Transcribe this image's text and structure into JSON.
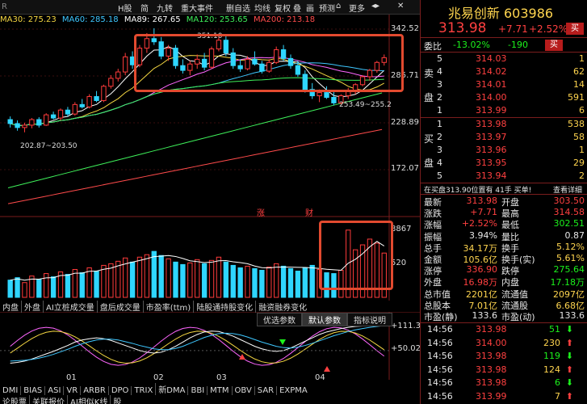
{
  "toolbar": {
    "r_label": "R",
    "items": [
      "H股",
      "简",
      "九转",
      "重大事件",
      "删自选",
      "均线",
      "复权",
      "叠",
      "画",
      "预测",
      "更多"
    ],
    "icons": [
      "home-icon",
      "expand-icon",
      "close-icon"
    ]
  },
  "ma": {
    "items": [
      {
        "label": "MA30: 275.23",
        "color": "#f5d742"
      },
      {
        "label": "MA60: 285.18",
        "color": "#3ec7ff"
      },
      {
        "label": "MA89: 267.65",
        "color": "#ffffff"
      },
      {
        "label": "MA120: 253.65",
        "color": "#3ef05a"
      },
      {
        "label": "MA200: 213.18",
        "color": "#ff4b4b"
      }
    ]
  },
  "yaxis": {
    "main": [
      "342.52",
      "285.71",
      "228.89",
      "172.07"
    ],
    "vol": [
      "8867",
      "520"
    ],
    "ind": [
      "+111.3",
      "+50.02"
    ]
  },
  "annot": {
    "high": "351.10",
    "mid": "253.49~255.2",
    "low": "202.87~203.50",
    "e1": "涨",
    "e2": "财"
  },
  "xticks": [
    "01",
    "02",
    "03",
    "04"
  ],
  "tabs1": [
    "内盘",
    "外盘",
    "AI立桩成交量",
    "盘后成交量",
    "市盈率(ttm)",
    "陆股通持股变化",
    "融资融券变化"
  ],
  "buttons": [
    "优选参数",
    "默认参数",
    "指标说明"
  ],
  "tabs2": [
    "DMI",
    "BIAS",
    "ASI",
    "VR",
    "ARBR",
    "DPO",
    "TRIX",
    "新DMA",
    "BBI",
    "MTM",
    "OBV",
    "SAR",
    "EXPMA"
  ],
  "tabs3": [
    "论股票",
    "关联报价",
    "AI相似K线",
    "股"
  ],
  "chart_data": {
    "type": "candlestick",
    "main_ylim": [
      120,
      350
    ],
    "vol_ylim": [
      0,
      8867
    ],
    "candles": [
      [
        236,
        240,
        226,
        231
      ],
      [
        231,
        235,
        222,
        226
      ],
      [
        226,
        232,
        220,
        229
      ],
      [
        229,
        238,
        225,
        236
      ],
      [
        236,
        239,
        226,
        229
      ],
      [
        229,
        244,
        228,
        242
      ],
      [
        242,
        246,
        236,
        238
      ],
      [
        238,
        250,
        235,
        248
      ],
      [
        248,
        252,
        240,
        243
      ],
      [
        243,
        258,
        241,
        255
      ],
      [
        255,
        262,
        250,
        252
      ],
      [
        252,
        268,
        250,
        265
      ],
      [
        265,
        272,
        258,
        260
      ],
      [
        260,
        280,
        258,
        278
      ],
      [
        278,
        292,
        275,
        288
      ],
      [
        288,
        300,
        284,
        296
      ],
      [
        296,
        320,
        292,
        315
      ],
      [
        315,
        322,
        300,
        305
      ],
      [
        305,
        330,
        302,
        326
      ],
      [
        326,
        345,
        320,
        338
      ],
      [
        338,
        351,
        330,
        334
      ],
      [
        334,
        340,
        312,
        316
      ],
      [
        316,
        330,
        310,
        326
      ],
      [
        326,
        330,
        300,
        304
      ],
      [
        304,
        312,
        294,
        298
      ],
      [
        298,
        310,
        292,
        306
      ],
      [
        306,
        318,
        300,
        312
      ],
      [
        312,
        320,
        298,
        302
      ],
      [
        302,
        328,
        300,
        325
      ],
      [
        325,
        340,
        322,
        336
      ],
      [
        336,
        342,
        316,
        320
      ],
      [
        320,
        326,
        300,
        304
      ],
      [
        304,
        312,
        296,
        300
      ],
      [
        300,
        316,
        298,
        312
      ],
      [
        312,
        322,
        304,
        306
      ],
      [
        306,
        310,
        294,
        297
      ],
      [
        297,
        312,
        295,
        308
      ],
      [
        308,
        328,
        306,
        324
      ],
      [
        324,
        330,
        310,
        313
      ],
      [
        313,
        318,
        300,
        304
      ],
      [
        304,
        310,
        290,
        293
      ],
      [
        293,
        298,
        270,
        274
      ],
      [
        274,
        282,
        262,
        266
      ],
      [
        266,
        274,
        258,
        270
      ],
      [
        270,
        278,
        262,
        264
      ],
      [
        264,
        272,
        254,
        257
      ],
      [
        257,
        268,
        255,
        266
      ],
      [
        266,
        276,
        262,
        272
      ],
      [
        272,
        282,
        268,
        280
      ],
      [
        280,
        292,
        278,
        290
      ],
      [
        290,
        300,
        285,
        298
      ],
      [
        298,
        310,
        295,
        308
      ],
      [
        308,
        318,
        304,
        314
      ]
    ],
    "volumes": [
      2100,
      2400,
      1800,
      2600,
      2200,
      2900,
      2500,
      3100,
      2800,
      3400,
      3000,
      3600,
      3200,
      3900,
      4100,
      4400,
      4800,
      4300,
      4900,
      5200,
      5600,
      5100,
      4700,
      4300,
      4000,
      4200,
      4600,
      4100,
      4500,
      4900,
      4300,
      3900,
      3600,
      3800,
      3500,
      3300,
      3700,
      4100,
      3800,
      3500,
      3200,
      3600,
      3900,
      3400,
      3000,
      2900,
      3300,
      8200,
      5800,
      6400,
      7100,
      6600,
      5400
    ],
    "macd_dif": [
      20,
      22,
      25,
      30,
      36,
      42,
      48,
      55,
      62,
      70,
      75,
      78,
      80,
      78,
      74,
      68,
      62,
      56,
      50,
      46,
      44,
      46,
      52,
      60,
      70,
      80,
      88,
      94,
      96,
      95,
      90,
      84,
      76,
      68,
      60,
      54,
      50,
      48,
      50,
      56,
      64,
      72,
      80,
      88,
      94,
      98,
      102,
      105,
      107,
      108,
      110,
      111,
      111
    ],
    "macd_dea": [
      25,
      26,
      27,
      29,
      32,
      36,
      41,
      47,
      53,
      60,
      66,
      71,
      75,
      77,
      77,
      75,
      71,
      67,
      62,
      58,
      54,
      52,
      52,
      55,
      60,
      67,
      74,
      81,
      86,
      90,
      91,
      90,
      87,
      82,
      76,
      70,
      65,
      60,
      57,
      56,
      58,
      62,
      67,
      73,
      79,
      85,
      90,
      95,
      99,
      102,
      105,
      107,
      109
    ]
  },
  "panel": {
    "title": "兆易创新 603986",
    "price": "313.98",
    "change": "+7.71",
    "pct": "+2.52%",
    "add_btn": "买",
    "weibi_label": "委比",
    "weibi_value": "-13.02%",
    "weicha_value": "-190",
    "sell_btn": "买",
    "sell_side": "卖",
    "sell_side2": "盘",
    "buy_side": "买",
    "buy_side2": "盘",
    "sells": [
      {
        "n": "5",
        "p": "314.03",
        "v": "1"
      },
      {
        "n": "4",
        "p": "314.02",
        "v": "62"
      },
      {
        "n": "3",
        "p": "314.01",
        "v": "14"
      },
      {
        "n": "2",
        "p": "314.00",
        "v": "591"
      },
      {
        "n": "1",
        "p": "313.99",
        "v": "6"
      }
    ],
    "buys": [
      {
        "n": "1",
        "p": "313.98",
        "v": "538"
      },
      {
        "n": "2",
        "p": "313.97",
        "v": "58"
      },
      {
        "n": "3",
        "p": "313.96",
        "v": "1"
      },
      {
        "n": "4",
        "p": "313.95",
        "v": "29"
      },
      {
        "n": "5",
        "p": "313.94",
        "v": "2"
      }
    ],
    "notice": "在买盘313.90位置有 41手 买单!",
    "notice_link": "查看详细",
    "stats": [
      {
        "l1": "最新",
        "v1": "313.98",
        "c1": "red",
        "l2": "开盘",
        "v2": "303.50",
        "c2": "red"
      },
      {
        "l1": "涨跌",
        "v1": "+7.71",
        "c1": "red",
        "l2": "最高",
        "v2": "314.58",
        "c2": "red"
      },
      {
        "l1": "涨幅",
        "v1": "+2.52%",
        "c1": "red",
        "l2": "最低",
        "v2": "302.51",
        "c2": "green"
      },
      {
        "l1": "振幅",
        "v1": "3.94%",
        "c1": "white",
        "l2": "量比",
        "v2": "0.87",
        "c2": "white"
      },
      {
        "l1": "总手",
        "v1": "34.17万",
        "c1": "yel",
        "l2": "换手",
        "v2": "5.12%",
        "c2": "yel"
      },
      {
        "l1": "金额",
        "v1": "105.6亿",
        "c1": "yel",
        "l2": "换手(实)",
        "v2": "5.61%",
        "c2": "yel"
      },
      {
        "l1": "涨停",
        "v1": "336.90",
        "c1": "red",
        "l2": "跌停",
        "v2": "275.64",
        "c2": "green"
      },
      {
        "l1": "外盘",
        "v1": "16.98万",
        "c1": "red",
        "l2": "内盘",
        "v2": "17.18万",
        "c2": "green"
      },
      {
        "l1": "总市值",
        "v1": "2201亿",
        "c1": "yel",
        "l2": "流通值",
        "v2": "2097亿",
        "c2": "yel"
      },
      {
        "l1": "总股本",
        "v1": "7.01亿",
        "c1": "yel",
        "l2": "流通股",
        "v2": "6.68亿",
        "c2": "yel"
      },
      {
        "l1": "市盈(静)",
        "v1": "133.6",
        "c1": "white",
        "l2": "市盈(动)",
        "v2": "133.6",
        "c2": "white"
      }
    ],
    "trades": [
      {
        "t": "14:56",
        "p": "313.98",
        "v": "51",
        "dir": "down"
      },
      {
        "t": "14:56",
        "p": "314.00",
        "v": "230",
        "dir": "up"
      },
      {
        "t": "14:56",
        "p": "313.98",
        "v": "119",
        "dir": "down"
      },
      {
        "t": "14:56",
        "p": "313.98",
        "v": "124",
        "dir": "up"
      },
      {
        "t": "14:56",
        "p": "313.98",
        "v": "6",
        "dir": "down"
      },
      {
        "t": "14:56",
        "p": "313.99",
        "v": "7",
        "dir": "up"
      }
    ]
  }
}
